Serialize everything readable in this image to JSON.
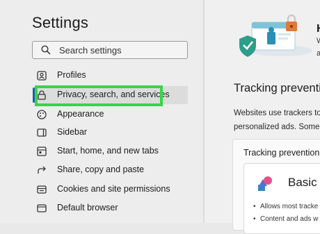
{
  "sidebar": {
    "title": "Settings",
    "search_placeholder": "Search settings",
    "items": [
      {
        "label": "Profiles",
        "icon": "profile-icon"
      },
      {
        "label": "Privacy, search, and services",
        "icon": "lock-icon"
      },
      {
        "label": "Appearance",
        "icon": "appearance-icon"
      },
      {
        "label": "Sidebar",
        "icon": "sidebar-icon"
      },
      {
        "label": "Start, home, and new tabs",
        "icon": "home-tabs-icon"
      },
      {
        "label": "Share, copy and paste",
        "icon": "share-icon"
      },
      {
        "label": "Cookies and site permissions",
        "icon": "cookies-icon"
      },
      {
        "label": "Default browser",
        "icon": "browser-icon"
      }
    ],
    "selected_index": 1
  },
  "main": {
    "header_partial": "Hi",
    "header_sub_1": "W",
    "header_sub_2": "a",
    "section_title": "Tracking preventi",
    "desc_line1": "Websites use trackers to",
    "desc_line2": "personalized ads. Some",
    "card_title": "Tracking prevention",
    "option_label": "Basic",
    "bullets": [
      "Allows most tracke",
      "Content and ads w"
    ]
  },
  "colors": {
    "accent": "#1a5fb4",
    "highlight": "#39d34a"
  }
}
